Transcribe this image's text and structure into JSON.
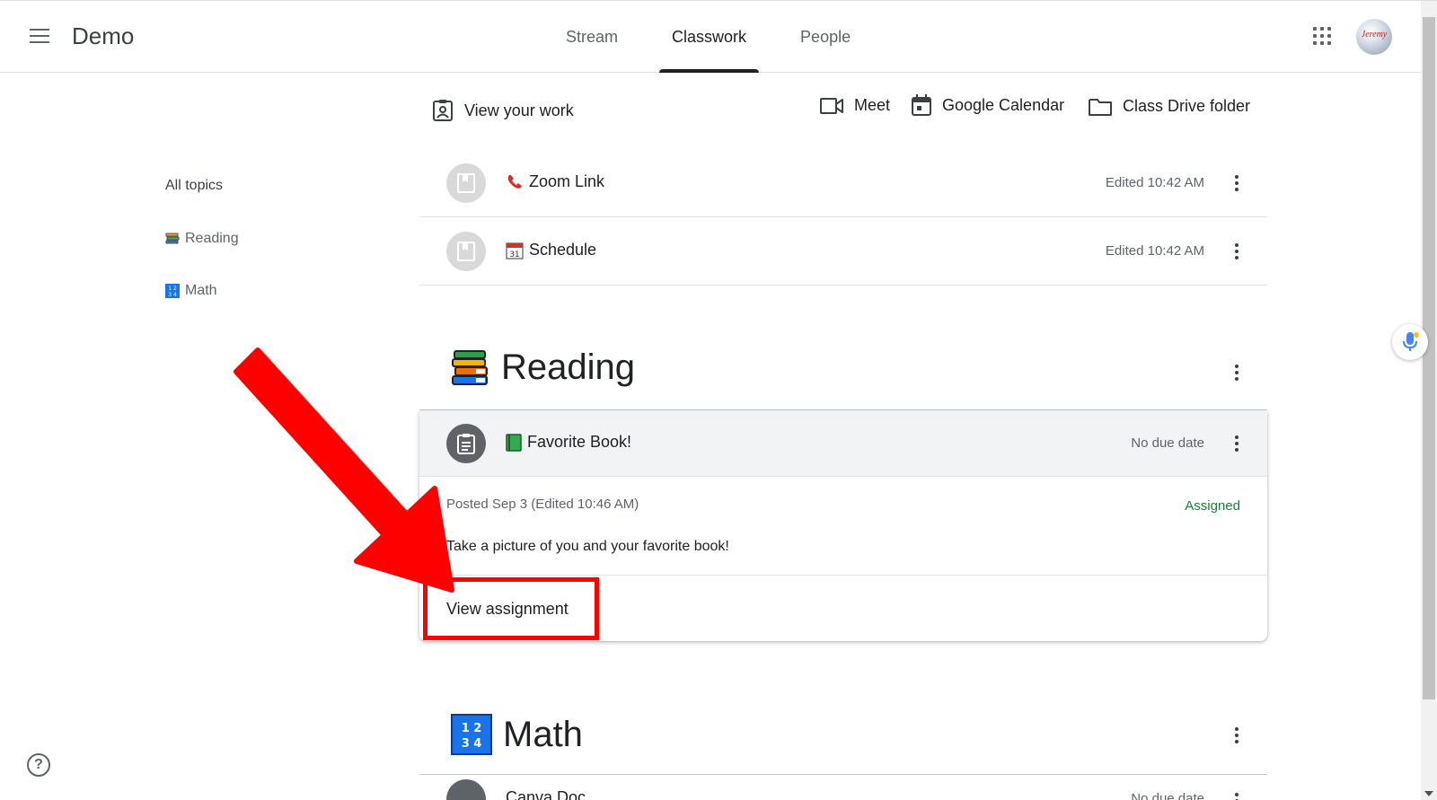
{
  "header": {
    "class_name": "Demo",
    "tabs": [
      {
        "label": "Stream",
        "active": false
      },
      {
        "label": "Classwork",
        "active": true
      },
      {
        "label": "People",
        "active": false
      }
    ],
    "avatar_text": "Jeremy"
  },
  "toolbar": {
    "view_work_label": "View your work",
    "meet_label": "Meet",
    "calendar_label": "Google Calendar",
    "drive_label": "Class Drive folder"
  },
  "sidebar": {
    "all_topics": "All topics",
    "topics": [
      {
        "label": "Reading",
        "icon": "books-icon"
      },
      {
        "label": "Math",
        "icon": "numbers-icon"
      }
    ]
  },
  "materials": [
    {
      "title": "Zoom Link",
      "emoji": "telephone-icon",
      "meta": "Edited 10:42 AM"
    },
    {
      "title": "Schedule",
      "emoji": "calendar-icon",
      "meta": "Edited 10:42 AM"
    }
  ],
  "reading": {
    "title": "Reading",
    "assignment": {
      "title": "Favorite Book!",
      "due": "No due date",
      "posted": "Posted Sep 3 (Edited 10:46 AM)",
      "status": "Assigned",
      "description": "Take a picture of you and your favorite book!",
      "view_label": "View assignment"
    }
  },
  "math": {
    "title": "Math",
    "first_item": {
      "title": "Canva Doc",
      "due": "No due date"
    }
  },
  "colors": {
    "accent_active": "#202124",
    "status_green": "#188038",
    "annotation_red": "#ff0000"
  }
}
